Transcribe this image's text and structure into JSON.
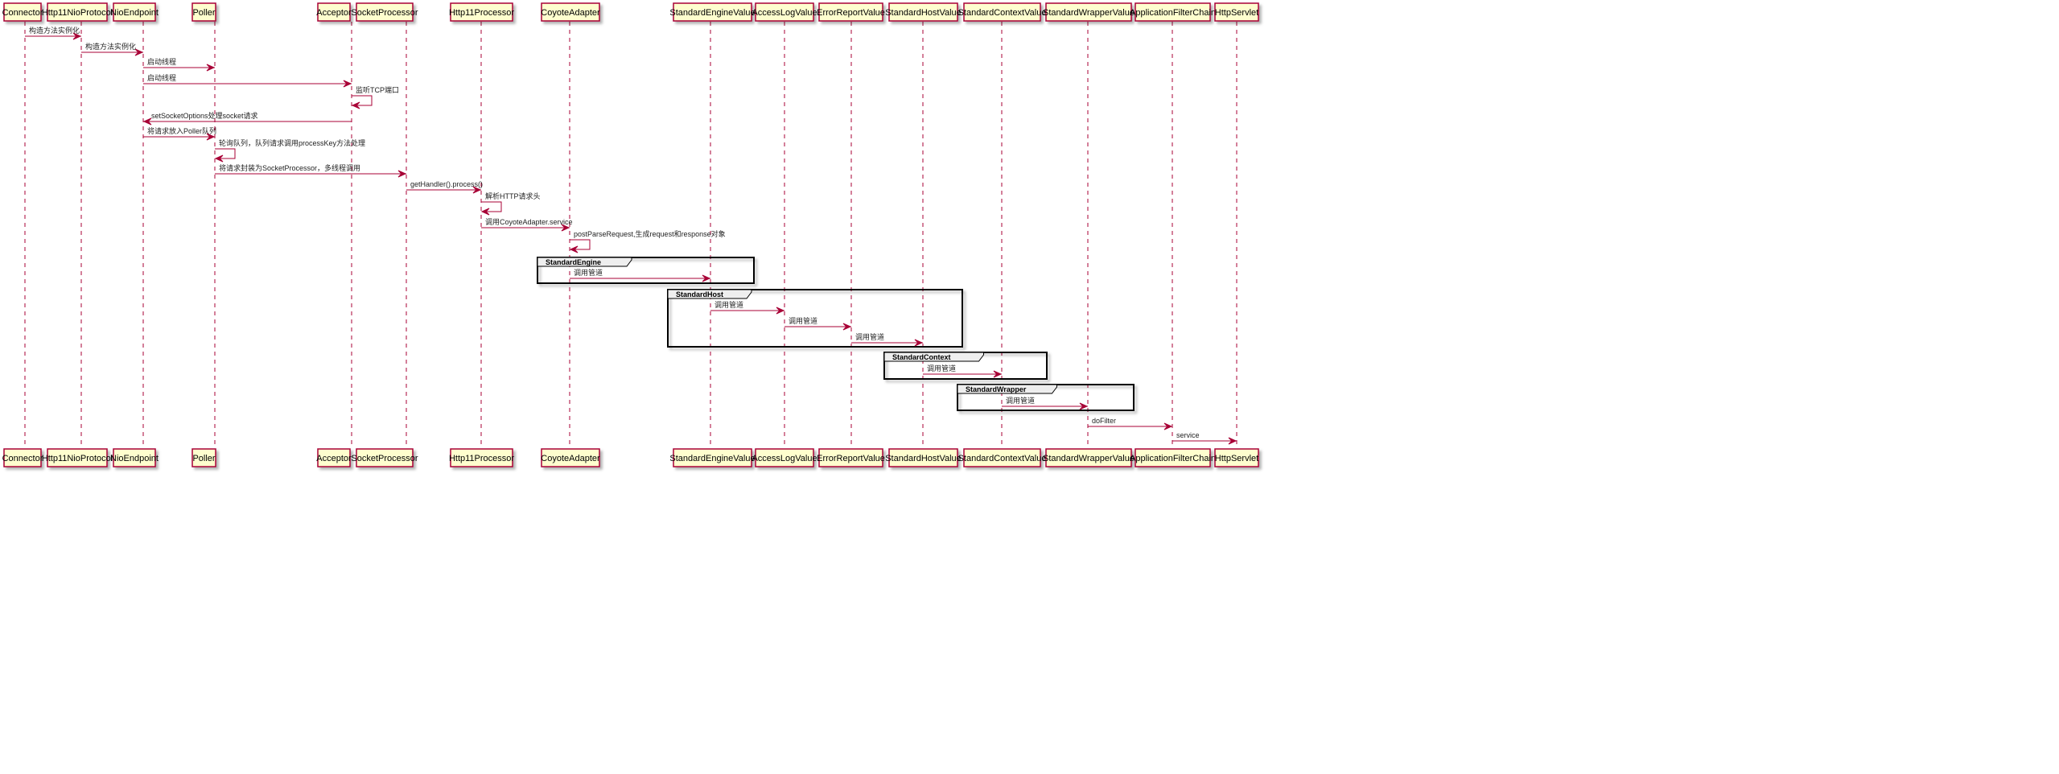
{
  "colors": {
    "participant_fill": "#FEFECE",
    "participant_border": "#A80036",
    "arrow": "#A80036",
    "lifeline": "#A80036",
    "group_header_fill": "#EEEEEE",
    "text": "#000000"
  },
  "participants": [
    "Connector",
    "Http11NioProtocol",
    "NioEndpoint",
    "Poller",
    "Acceptor",
    "SocketProcessor",
    "Http11Processor",
    "CoyoteAdapter",
    "StandardEngineValue",
    "AccessLogValue",
    "ErrorReportValue",
    "StandardHostValue",
    "StandardContextValue",
    "StandardWrapperValue",
    "ApplicationFilterChain",
    "HttpServlet"
  ],
  "messages": [
    {
      "from": 0,
      "to": 1,
      "text": "构造方法实例化"
    },
    {
      "from": 1,
      "to": 2,
      "text": "构造方法实例化"
    },
    {
      "from": 2,
      "to": 3,
      "text": "启动线程"
    },
    {
      "from": 2,
      "to": 4,
      "text": "启动线程"
    },
    {
      "from": 4,
      "to": 4,
      "text": "监听TCP端口"
    },
    {
      "from": 4,
      "to": 2,
      "text": "setSocketOptions处理socket请求"
    },
    {
      "from": 2,
      "to": 3,
      "text": "将请求放入Poller队列"
    },
    {
      "from": 3,
      "to": 3,
      "text": "轮询队列，队列请求调用processKey方法处理"
    },
    {
      "from": 3,
      "to": 5,
      "text": "将请求封装为SocketProcessor，多线程调用"
    },
    {
      "from": 5,
      "to": 6,
      "text": "getHandler().process()"
    },
    {
      "from": 6,
      "to": 6,
      "text": "解析HTTP请求头"
    },
    {
      "from": 6,
      "to": 7,
      "text": "调用CoyoteAdapter.service"
    },
    {
      "from": 7,
      "to": 7,
      "text": "postParseRequest,生成request和response对象"
    },
    {
      "from": 7,
      "to": 8,
      "text": "调用管道",
      "group": 0
    },
    {
      "from": 8,
      "to": 9,
      "text": "调用管道",
      "group": 1
    },
    {
      "from": 9,
      "to": 10,
      "text": "调用管道",
      "group": 1
    },
    {
      "from": 10,
      "to": 11,
      "text": "调用管道",
      "group": 1
    },
    {
      "from": 11,
      "to": 12,
      "text": "调用管道",
      "group": 2
    },
    {
      "from": 12,
      "to": 13,
      "text": "调用管道",
      "group": 3
    },
    {
      "from": 13,
      "to": 14,
      "text": "doFilter"
    },
    {
      "from": 14,
      "to": 15,
      "text": "service"
    }
  ],
  "groups": [
    {
      "label": "StandardEngine"
    },
    {
      "label": "StandardHost"
    },
    {
      "label": "StandardContext"
    },
    {
      "label": "StandardWrapper"
    }
  ]
}
